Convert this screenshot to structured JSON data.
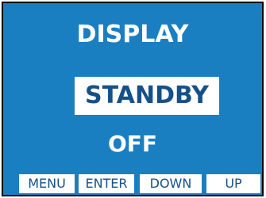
{
  "screen": {
    "title": "DISPLAY",
    "mode": "STANDBY",
    "value": "OFF"
  },
  "softkeys": [
    {
      "label": "MENU"
    },
    {
      "label": "ENTER"
    },
    {
      "label": "DOWN"
    },
    {
      "label": "UP"
    }
  ],
  "colors": {
    "screen_background": "#1a7fc1",
    "highlight_background": "#ffffff",
    "highlight_text": "#16508a",
    "text": "#ffffff"
  }
}
